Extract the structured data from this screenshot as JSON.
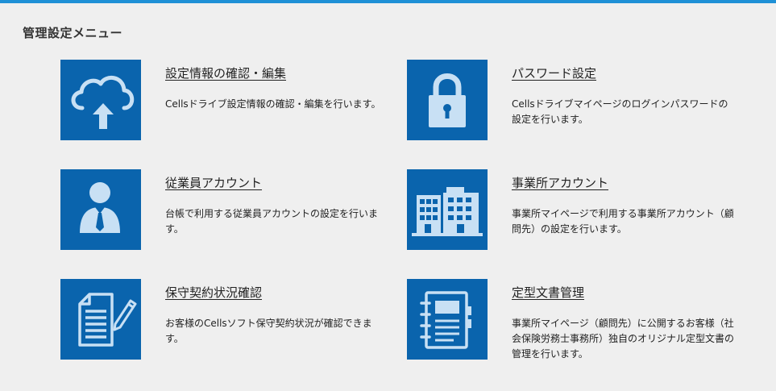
{
  "page": {
    "title": "管理設定メニュー",
    "accent_color": "#1e90d6",
    "tile_color": "#0a64ad",
    "icon_color": "#c8e0f4"
  },
  "menu": {
    "items": [
      {
        "title": "設定情報の確認・編集",
        "description": "Cellsドライブ設定情報の確認・編集を行います。",
        "icon": "cloud-upload-icon"
      },
      {
        "title": "パスワード設定",
        "description": "Cellsドライブマイページのログインパスワードの設定を行います。",
        "icon": "lock-icon"
      },
      {
        "title": "従業員アカウント",
        "description": "台帳で利用する従業員アカウントの設定を行います。",
        "icon": "employee-icon"
      },
      {
        "title": "事業所アカウント",
        "description": "事業所マイページで利用する事業所アカウント（顧問先）の設定を行います。",
        "icon": "building-icon"
      },
      {
        "title": "保守契約状況確認",
        "description": "お客様のCellsソフト保守契約状況が確認できます。",
        "icon": "document-pen-icon"
      },
      {
        "title": "定型文書管理",
        "description": "事業所マイページ（顧問先）に公開するお客様（社会保険労務士事務所）独自のオリジナル定型文書の管理を行います。",
        "icon": "notebook-icon"
      }
    ]
  }
}
